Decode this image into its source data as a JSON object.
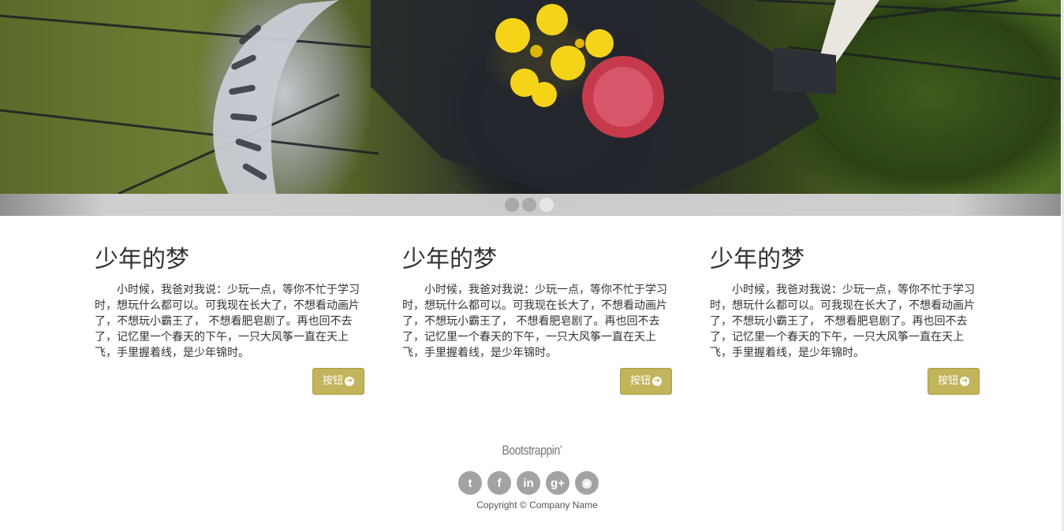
{
  "carousel": {
    "slide_count": 3,
    "active_index": 2
  },
  "columns": [
    {
      "title": "少年的梦",
      "body": "小时候，我爸对我说：少玩一点，等你不忙于学习时，想玩什么都可以。可我现在长大了，不想看动画片了，不想玩小霸王了， 不想看肥皂剧了。再也回不去了，记忆里一个春天的下午，一只大风筝一直在天上飞，手里握着线，是少年锦时。",
      "button_label": "按钮"
    },
    {
      "title": "少年的梦",
      "body": "小时候，我爸对我说：少玩一点，等你不忙于学习时，想玩什么都可以。可我现在长大了，不想看动画片了，不想玩小霸王了， 不想看肥皂剧了。再也回不去了，记忆里一个春天的下午，一只大风筝一直在天上飞，手里握着线，是少年锦时。",
      "button_label": "按钮"
    },
    {
      "title": "少年的梦",
      "body": "小时候，我爸对我说：少玩一点，等你不忙于学习时，想玩什么都可以。可我现在长大了，不想看动画片了，不想玩小霸王了， 不想看肥皂剧了。再也回不去了，记忆里一个春天的下午，一只大风筝一直在天上飞，手里握着线，是少年锦时。",
      "button_label": "按钮"
    }
  ],
  "footer": {
    "brand": "Bootstrappin’",
    "social": [
      {
        "icon": "twitter-icon",
        "glyph": "t"
      },
      {
        "icon": "facebook-icon",
        "glyph": "f"
      },
      {
        "icon": "linkedin-icon",
        "glyph": "in"
      },
      {
        "icon": "google-plus-icon",
        "glyph": "g+"
      },
      {
        "icon": "github-icon",
        "glyph": "◉"
      }
    ],
    "copyright": "Copyright © Company Name"
  },
  "colors": {
    "button": "#c2b45a",
    "social_icon": "#a3a3a3",
    "carousel_bar": "#cbcbcb"
  }
}
